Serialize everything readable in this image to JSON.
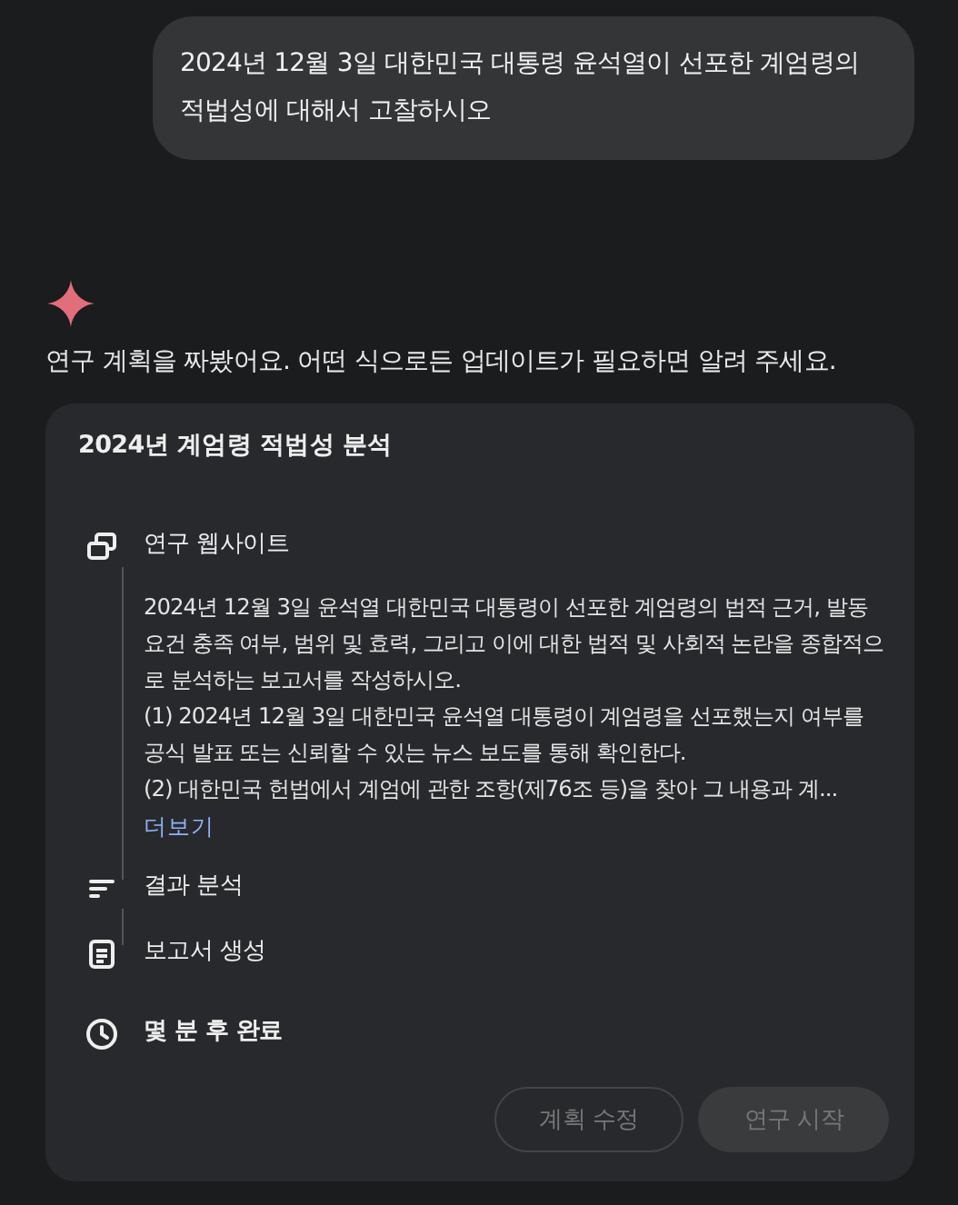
{
  "user_message": "2024년 12월 3일 대한민국 대통령 윤석열이 선포한 계엄령의 적법성에 대해서 고찰하시오",
  "response_text": "연구 계획을 짜봤어요. 어떤 식으로든 업데이트가 필요하면 알려 주세요.",
  "plan": {
    "title": "2024년 계엄령 적법성 분석",
    "steps": [
      {
        "kind": "website",
        "label": "연구 웹사이트",
        "description": [
          "2024년 12월 3일 윤석열 대한민국 대통령이 선포한 계엄령의 법적 근거, 발동 요건 충족 여부, 범위 및 효력, 그리고 이에 대한 법적 및 사회적 논란을 종합적으로 분석하는 보고서를 작성하시오.",
          "(1) 2024년 12월 3일 대한민국 윤석열 대통령이 계엄령을 선포했는지 여부를 공식 발표 또는 신뢰할 수 있는 뉴스 보도를 통해 확인한다.",
          "(2) 대한민국 헌법에서 계엄에 관한 조항(제76조 등)을 찾아 그 내용과 계..."
        ],
        "more": "더보기"
      },
      {
        "kind": "analysis",
        "label": "결과 분석"
      },
      {
        "kind": "report",
        "label": "보고서 생성"
      }
    ],
    "eta": "몇 분 후 완료",
    "buttons": [
      {
        "kind": "outline",
        "label": "계획 수정",
        "disabled": true
      },
      {
        "kind": "filled",
        "label": "연구 시작",
        "disabled": true
      }
    ]
  }
}
